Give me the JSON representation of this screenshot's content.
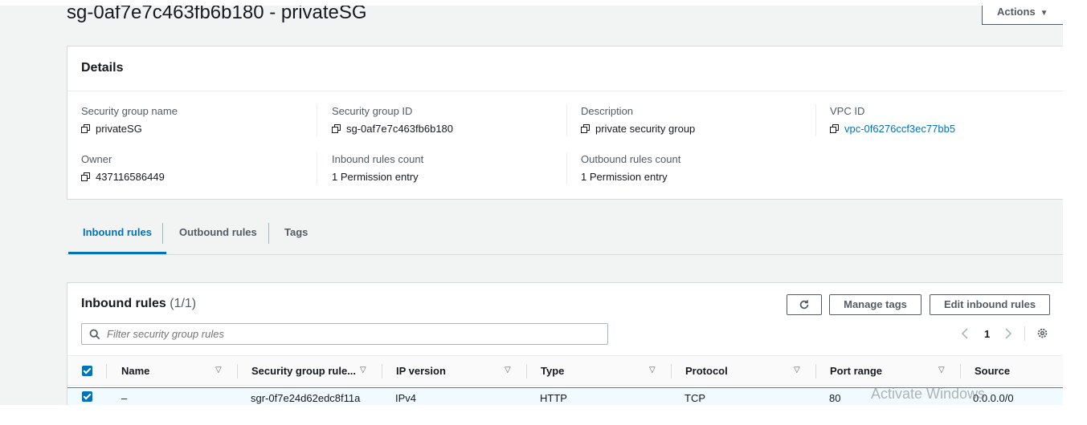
{
  "page": {
    "title": "sg-0af7e7c463fb6b180 - privateSG",
    "actions_label": "Actions"
  },
  "details": {
    "heading": "Details",
    "fields": [
      {
        "label": "Security group name",
        "value": "privateSG"
      },
      {
        "label": "Security group ID",
        "value": "sg-0af7e7c463fb6b180"
      },
      {
        "label": "Description",
        "value": "private security group"
      },
      {
        "label": "VPC ID",
        "value": "vpc-0f6276ccf3ec77bb5"
      },
      {
        "label": "Owner",
        "value": "437116586449"
      },
      {
        "label": "Inbound rules count",
        "value": "1 Permission entry"
      },
      {
        "label": "Outbound rules count",
        "value": "1 Permission entry"
      }
    ]
  },
  "tabs": [
    {
      "label": "Inbound rules",
      "active": true
    },
    {
      "label": "Outbound rules",
      "active": false
    },
    {
      "label": "Tags",
      "active": false
    }
  ],
  "inbound": {
    "title": "Inbound rules",
    "count": "(1/1)",
    "manage_tags_label": "Manage tags",
    "edit_label": "Edit inbound rules",
    "search_placeholder": "Filter security group rules",
    "page_number": "1",
    "columns": [
      "Name",
      "Security group rule...",
      "IP version",
      "Type",
      "Protocol",
      "Port range",
      "Source"
    ],
    "rows": [
      {
        "name": "–",
        "rule_id": "sgr-0f7e24d62edc8f11a",
        "ip_version": "IPv4",
        "type": "HTTP",
        "protocol": "TCP",
        "port_range": "80",
        "source": "0.0.0.0/0"
      }
    ]
  },
  "watermark": "Activate Windows",
  "icons": {
    "copy": "copy-icon",
    "refresh": "refresh-icon",
    "search": "search-icon",
    "settings": "gear-icon",
    "sort": "sort-caret-icon"
  },
  "colors": {
    "accent": "#0073bb",
    "background": "#f2f3f3",
    "selected_row": "#f1faff"
  }
}
